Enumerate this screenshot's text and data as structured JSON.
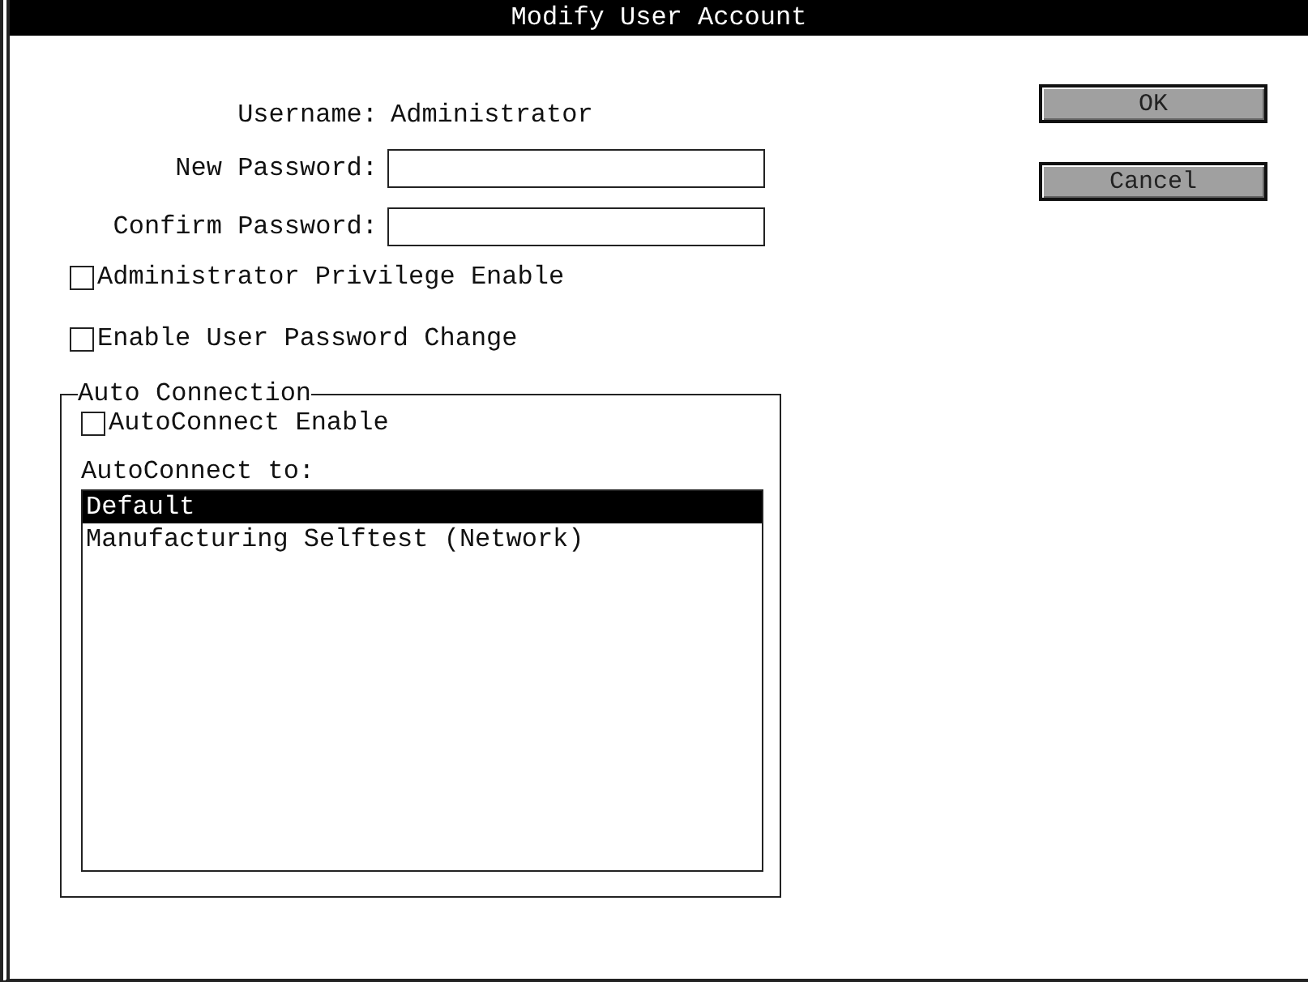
{
  "window": {
    "title": "Modify User Account"
  },
  "username": {
    "label": "Username:",
    "value": "Administrator"
  },
  "fields": [
    {
      "label": "New Password:"
    },
    {
      "label": "Confirm Password:"
    }
  ],
  "checkboxes": [
    {
      "label": "Administrator Privilege Enable",
      "checked": false
    },
    {
      "label": "Enable User Password Change",
      "checked": false
    }
  ],
  "auto_connection": {
    "title": "Auto Connection",
    "checkbox": {
      "label": "AutoConnect Enable",
      "checked": false
    },
    "list_label": "AutoConnect to:",
    "items": [
      {
        "label": "Default",
        "selected": true
      },
      {
        "label": "Manufacturing Selftest (Network)",
        "selected": false
      }
    ]
  },
  "buttons": [
    {
      "label": "OK"
    },
    {
      "label": "Cancel"
    }
  ]
}
